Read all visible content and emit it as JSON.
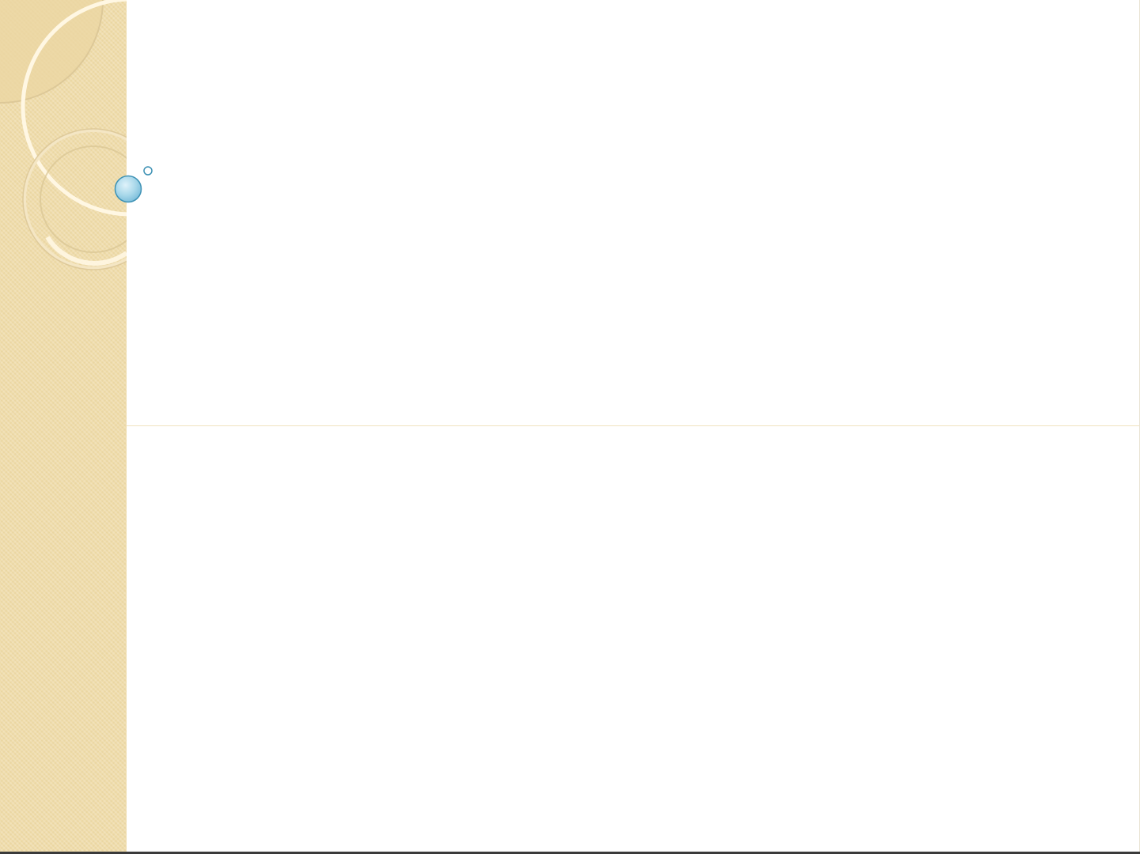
{
  "slide": {
    "title": "",
    "subtitle": ""
  },
  "colors": {
    "side_band": "#efdcaa",
    "divider": "#f0e3bf",
    "bubble_fill": "#a9d8ea",
    "bubble_stroke": "#3d91b4",
    "ring_cream": "#fff7e3",
    "ring_tan": "#d9c493"
  }
}
